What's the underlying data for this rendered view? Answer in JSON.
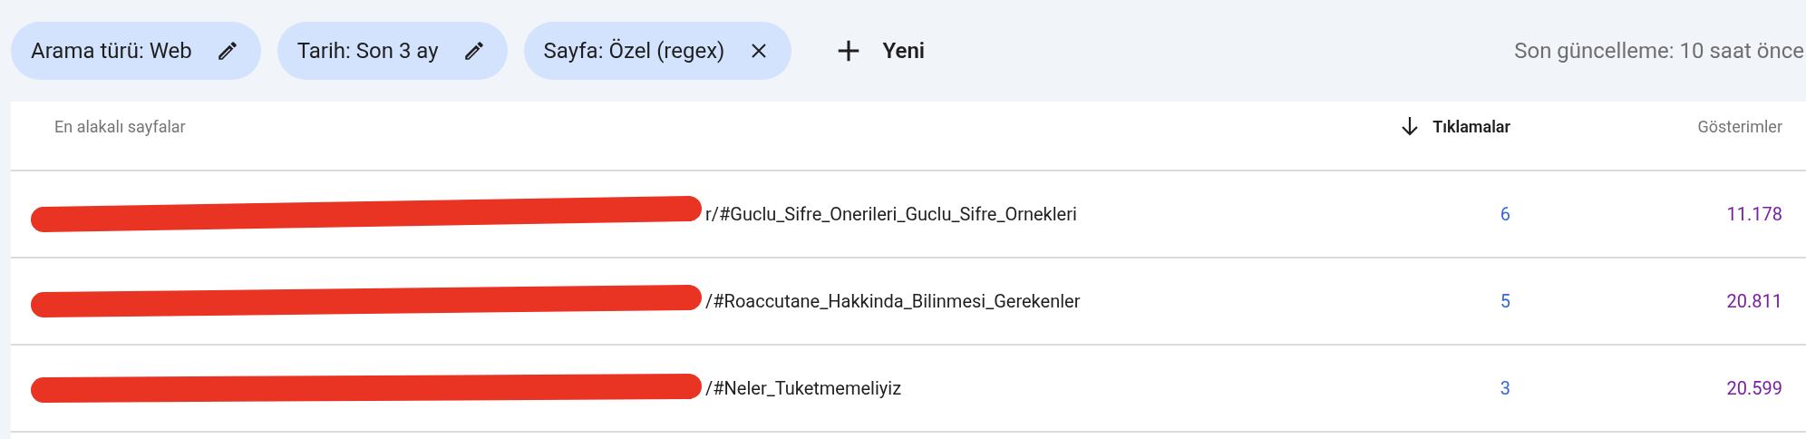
{
  "filters": [
    {
      "label": "Arama türü: Web",
      "kind": "edit"
    },
    {
      "label": "Tarih: Son 3 ay",
      "kind": "edit"
    },
    {
      "label": "Sayfa: Özel (regex)",
      "kind": "remove"
    }
  ],
  "new_button": {
    "label": "Yeni"
  },
  "last_update": "Son güncelleme: 10 saat önce",
  "table": {
    "columns": [
      {
        "label": "En alakalı sayfalar",
        "sorted": false
      },
      {
        "label": "Tıklamalar",
        "sorted": true
      },
      {
        "label": "Gösterimler",
        "sorted": false
      }
    ],
    "rows": [
      {
        "page": "r/#Guclu_Sifre_Onerileri_Guclu_Sifre_Ornekleri",
        "redacted": true,
        "clicks": "6",
        "impressions": "11.178"
      },
      {
        "page": "/#Roaccutane_Hakkinda_Bilinmesi_Gerekenler",
        "redacted": true,
        "clicks": "5",
        "impressions": "20.811"
      },
      {
        "page": "/#Neler_Tuketmemeliyiz",
        "redacted": true,
        "clicks": "3",
        "impressions": "20.599"
      }
    ]
  }
}
